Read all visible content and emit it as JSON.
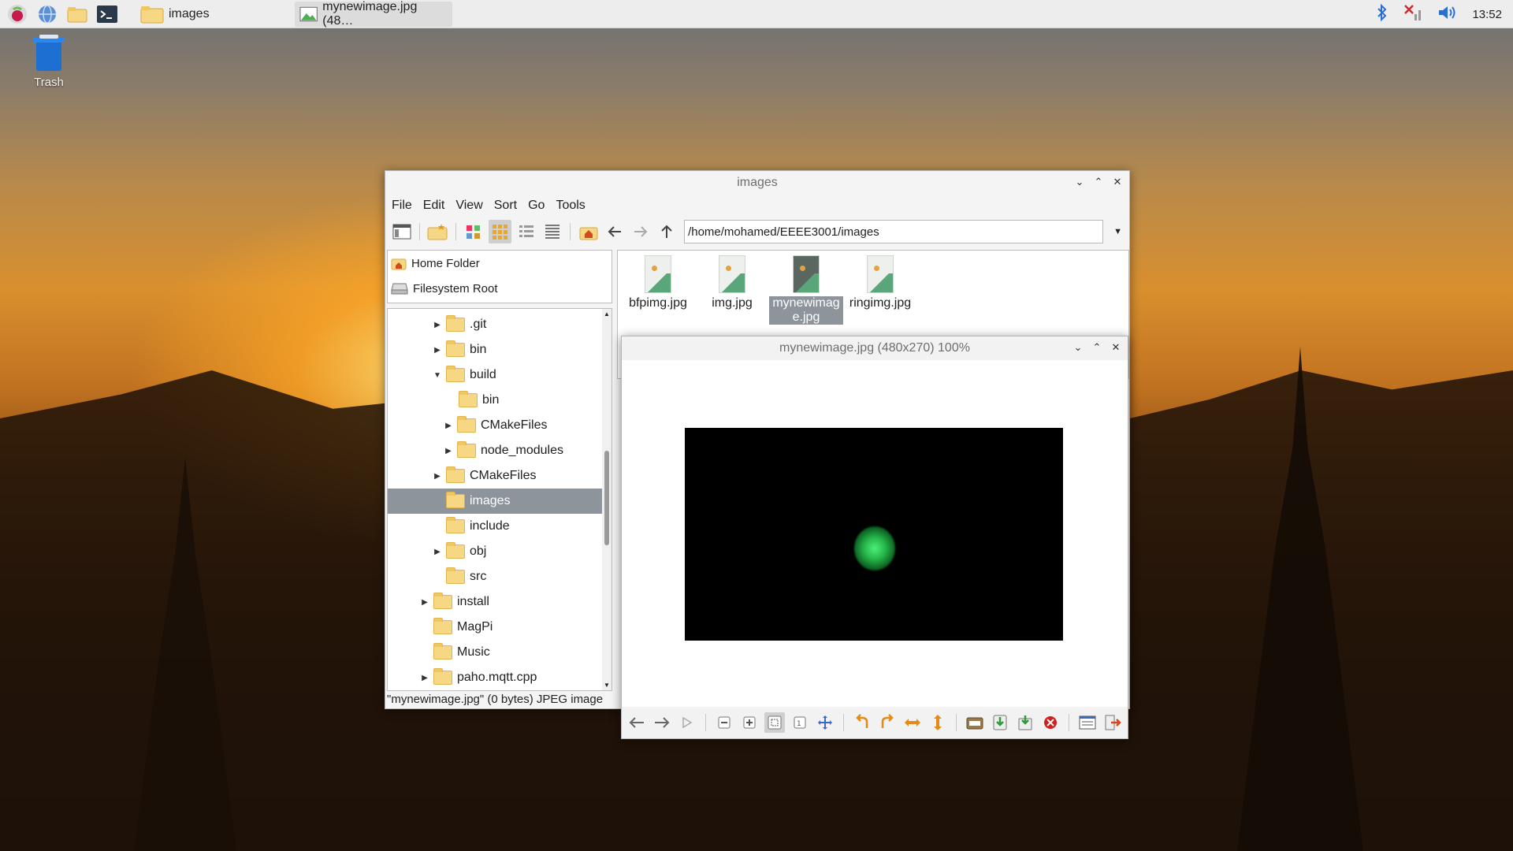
{
  "taskbar": {
    "tasks": [
      {
        "label": "images"
      },
      {
        "label": "mynewimage.jpg (48…"
      }
    ],
    "clock": "13:52"
  },
  "desktop": {
    "trash_label": "Trash"
  },
  "filemanager": {
    "title": "images",
    "menu": [
      "File",
      "Edit",
      "View",
      "Sort",
      "Go",
      "Tools"
    ],
    "path": "/home/mohamed/EEEE3001/images",
    "places": [
      "Home Folder",
      "Filesystem Root"
    ],
    "tree": [
      {
        "label": ".git"
      },
      {
        "label": "bin"
      },
      {
        "label": "build"
      },
      {
        "label": "bin"
      },
      {
        "label": "CMakeFiles"
      },
      {
        "label": "node_modules"
      },
      {
        "label": "CMakeFiles"
      },
      {
        "label": "images"
      },
      {
        "label": "include"
      },
      {
        "label": "obj"
      },
      {
        "label": "src"
      },
      {
        "label": "install"
      },
      {
        "label": "MagPi"
      },
      {
        "label": "Music"
      },
      {
        "label": "paho.mqtt.cpp"
      }
    ],
    "files": [
      {
        "label": "bfpimg.jpg"
      },
      {
        "label": "img.jpg"
      },
      {
        "label": "mynewimag e.jpg"
      },
      {
        "label": "ringimg.jpg"
      }
    ],
    "status": "\"mynewimage.jpg\" (0 bytes) JPEG image"
  },
  "viewer": {
    "title": "mynewimage.jpg (480x270) 100%"
  },
  "colors": {
    "selection": "#8d949c",
    "taskbar": "#ededed",
    "folder": "#f6d784"
  }
}
